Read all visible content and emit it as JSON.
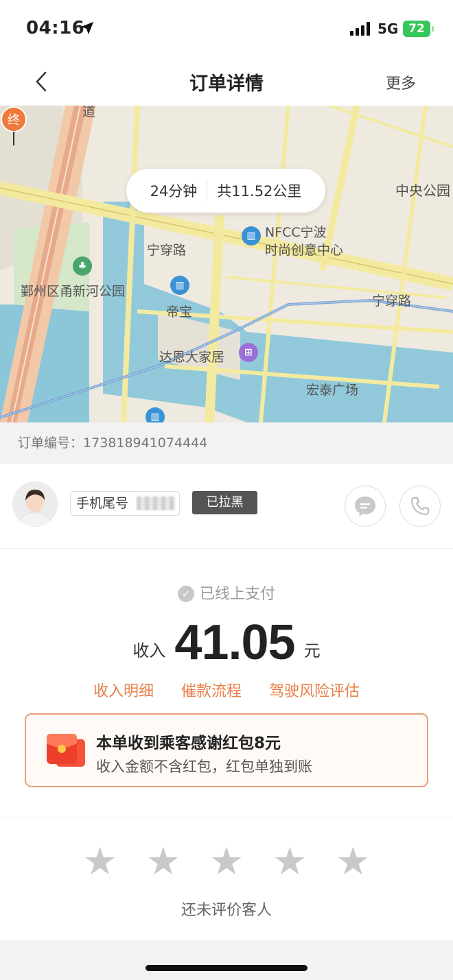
{
  "status_bar": {
    "time": "04:16",
    "network": "5G",
    "battery": "72"
  },
  "nav": {
    "title": "订单详情",
    "more": "更多"
  },
  "map": {
    "eta_time": "24分钟",
    "eta_distance": "共11.52公里",
    "end_marker": "终",
    "labels": {
      "dao": "道",
      "central_park": "中央公园",
      "nfcc_line1": "NFCC宁波",
      "nfcc_line2": "时尚创意中心",
      "ningchuan_road_1": "宁穿路",
      "ningchuan_road_2": "宁穿路",
      "park": "鄞州区甬新河公园",
      "dibao": "帝宝",
      "daen": "达恩大家居",
      "hongtai": "宏泰广场"
    }
  },
  "order": {
    "number_label": "订单编号：",
    "number": "173818941074444"
  },
  "passenger": {
    "phone_tail_label": "手机尾号",
    "blocked": "已拉黑"
  },
  "payment": {
    "status": "已线上支付",
    "income_label": "收入",
    "amount": "41.05",
    "unit": "元",
    "links": [
      "收入明细",
      "催款流程",
      "驾驶风险评估"
    ],
    "thanks_title": "本单收到乘客感谢红包8元",
    "thanks_sub": "收入金额不含红包，红包单独到账"
  },
  "rating": {
    "stars": 0,
    "max_stars": 5,
    "hint": "还未评价客人"
  },
  "colors": {
    "accent": "#e8804a",
    "route": "#6b9bd2",
    "end_pin": "#f07a3c"
  }
}
